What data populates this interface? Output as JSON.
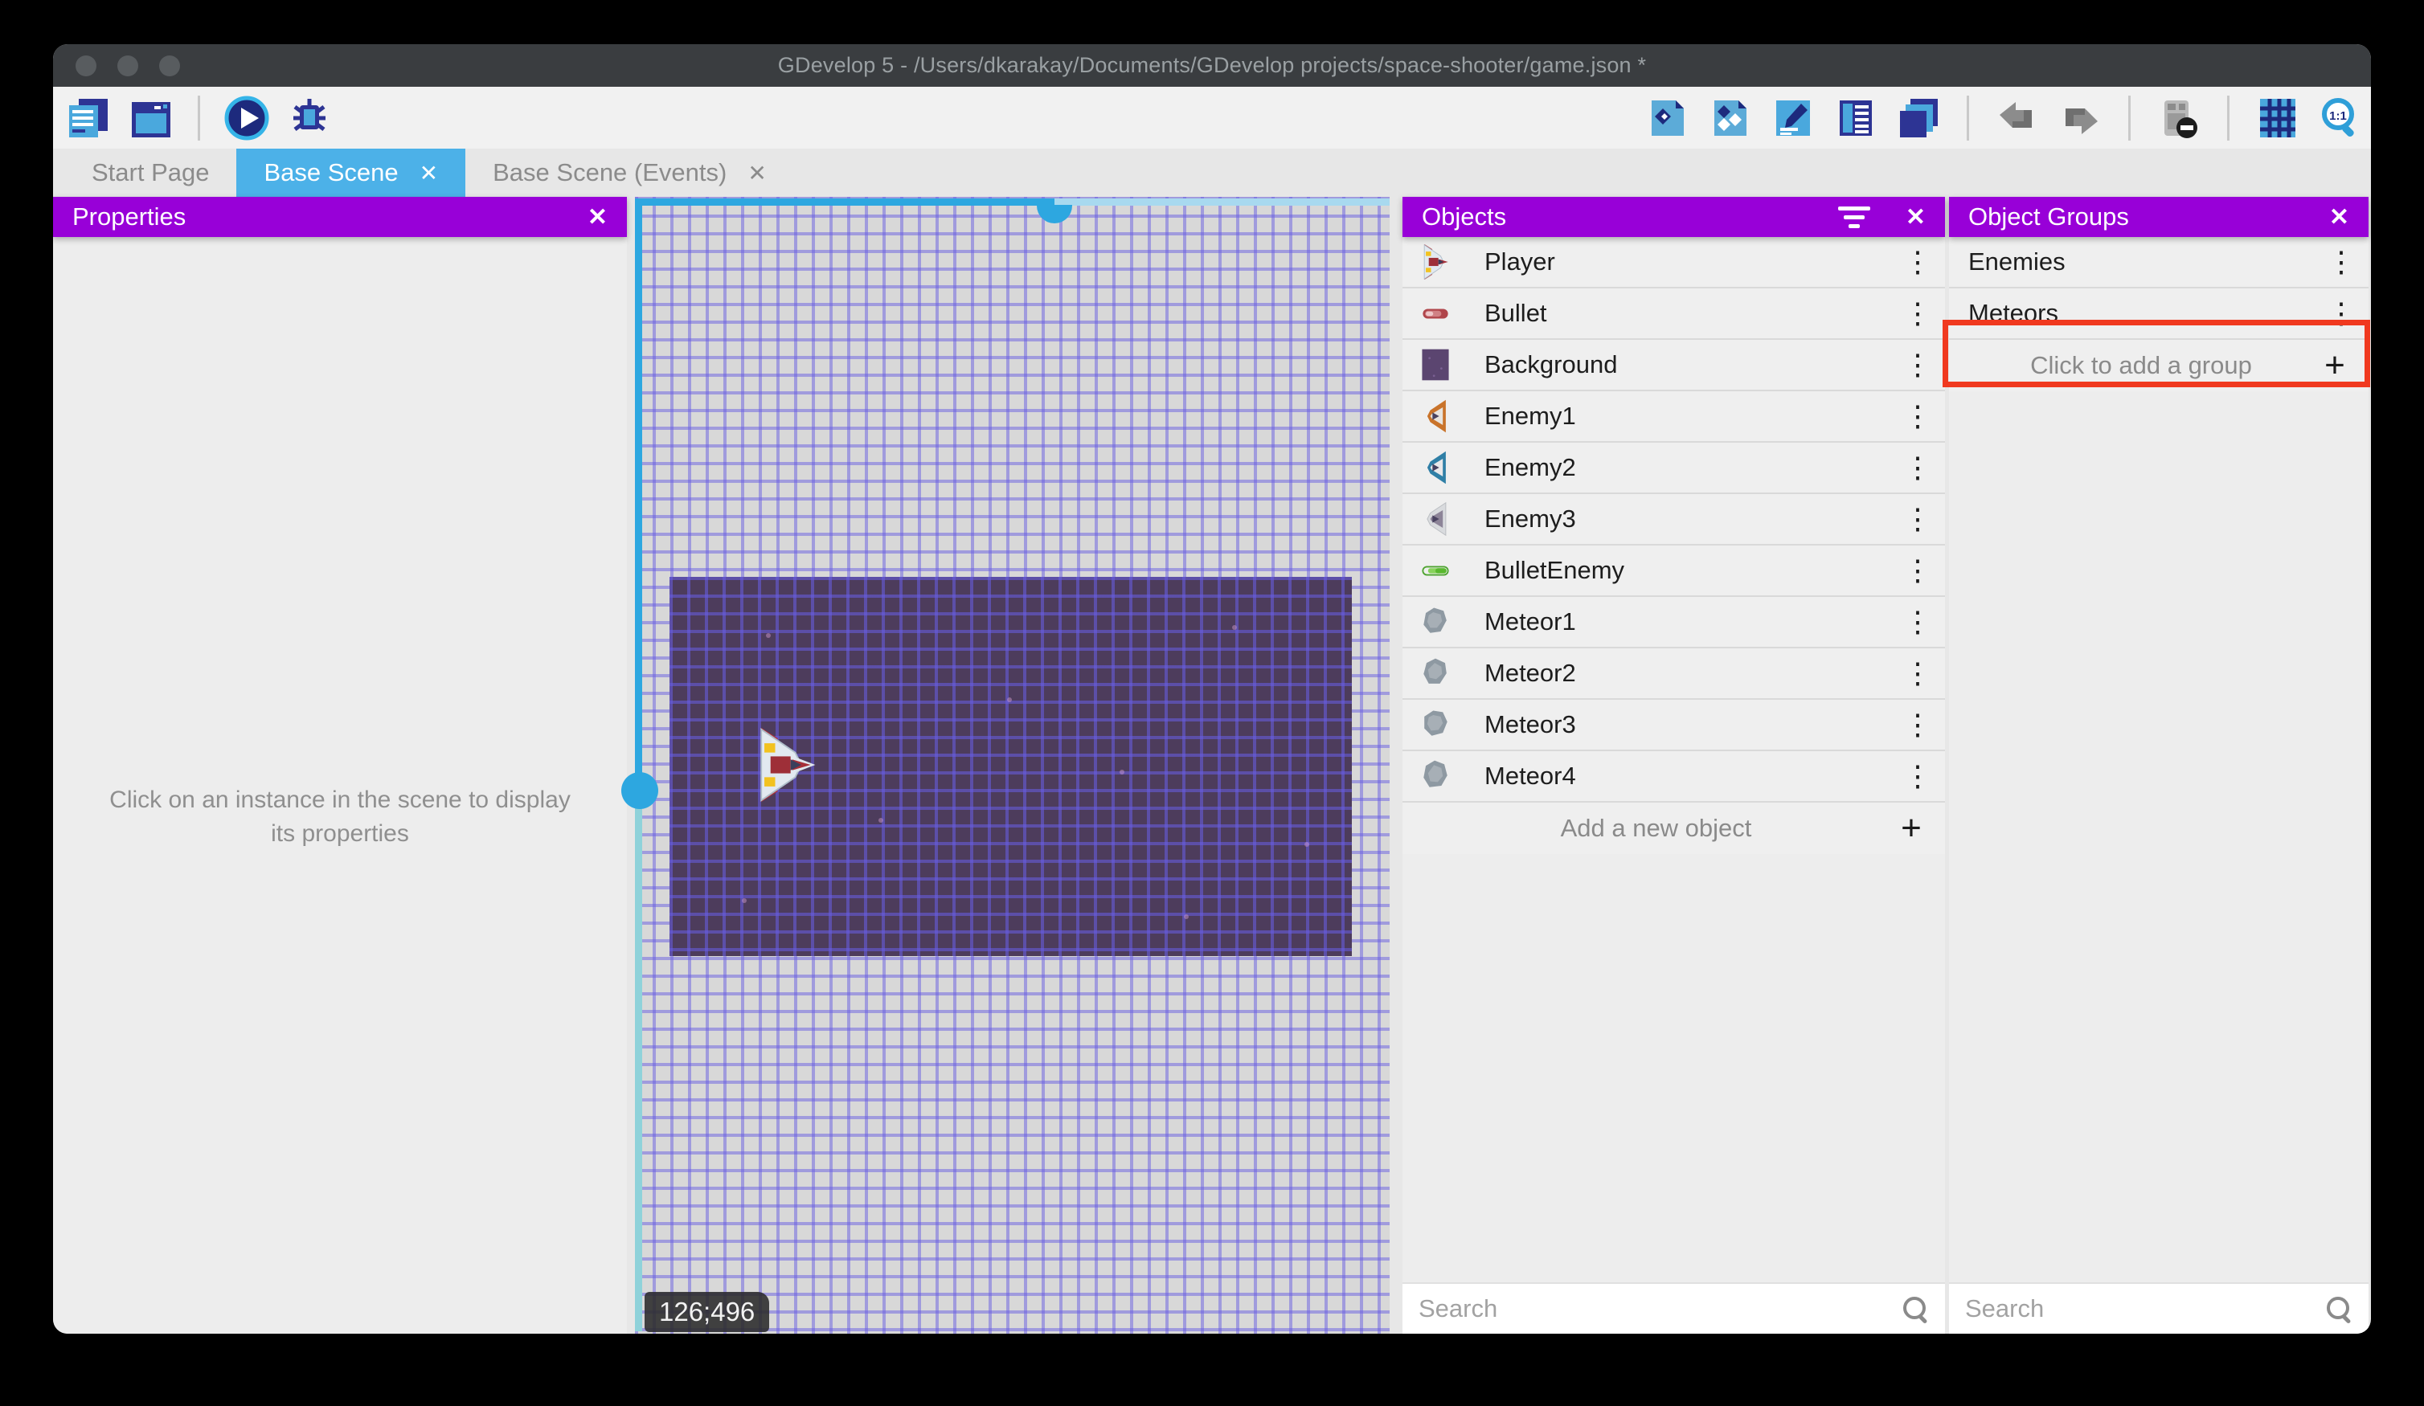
{
  "window_title": "GDevelop 5 - /Users/dkarakay/Documents/GDevelop projects/space-shooter/game.json *",
  "tabs": {
    "start_page": "Start Page",
    "base_scene": "Base Scene",
    "base_scene_events": "Base Scene (Events)"
  },
  "toolbar": {
    "left_icons": [
      "project-manager",
      "preview-window",
      "play-preview",
      "debug"
    ],
    "right_icons": [
      "objects-editor",
      "object-groups-editor",
      "properties-editor",
      "instances-list",
      "layers-editor",
      "undo",
      "redo",
      "delete-instances",
      "toggle-grid",
      "zoom-1-1"
    ]
  },
  "properties_panel": {
    "title": "Properties",
    "empty_message": "Click on an instance in the scene to display its properties"
  },
  "objects_panel": {
    "title": "Objects",
    "items": [
      {
        "name": "Player"
      },
      {
        "name": "Bullet"
      },
      {
        "name": "Background"
      },
      {
        "name": "Enemy1"
      },
      {
        "name": "Enemy2"
      },
      {
        "name": "Enemy3"
      },
      {
        "name": "BulletEnemy"
      },
      {
        "name": "Meteor1"
      },
      {
        "name": "Meteor2"
      },
      {
        "name": "Meteor3"
      },
      {
        "name": "Meteor4"
      }
    ],
    "add_label": "Add a new object",
    "search_placeholder": "Search"
  },
  "object_groups_panel": {
    "title": "Object Groups",
    "items": [
      {
        "name": "Enemies"
      },
      {
        "name": "Meteors"
      }
    ],
    "highlighted_item": "Meteors",
    "add_label": "Click to add a group",
    "search_placeholder": "Search"
  },
  "scene": {
    "cursor_coordinates": "126;496"
  },
  "glyphs": {
    "close": "✕",
    "kebab": "⋮",
    "plus": "+"
  },
  "colors": {
    "panel_header_purple": "#9800d8",
    "active_tab_blue": "#4cb1e8",
    "selection_blue": "#2da7e0",
    "annotation_red": "#f0391f",
    "titlebar": "#3a3d40"
  }
}
